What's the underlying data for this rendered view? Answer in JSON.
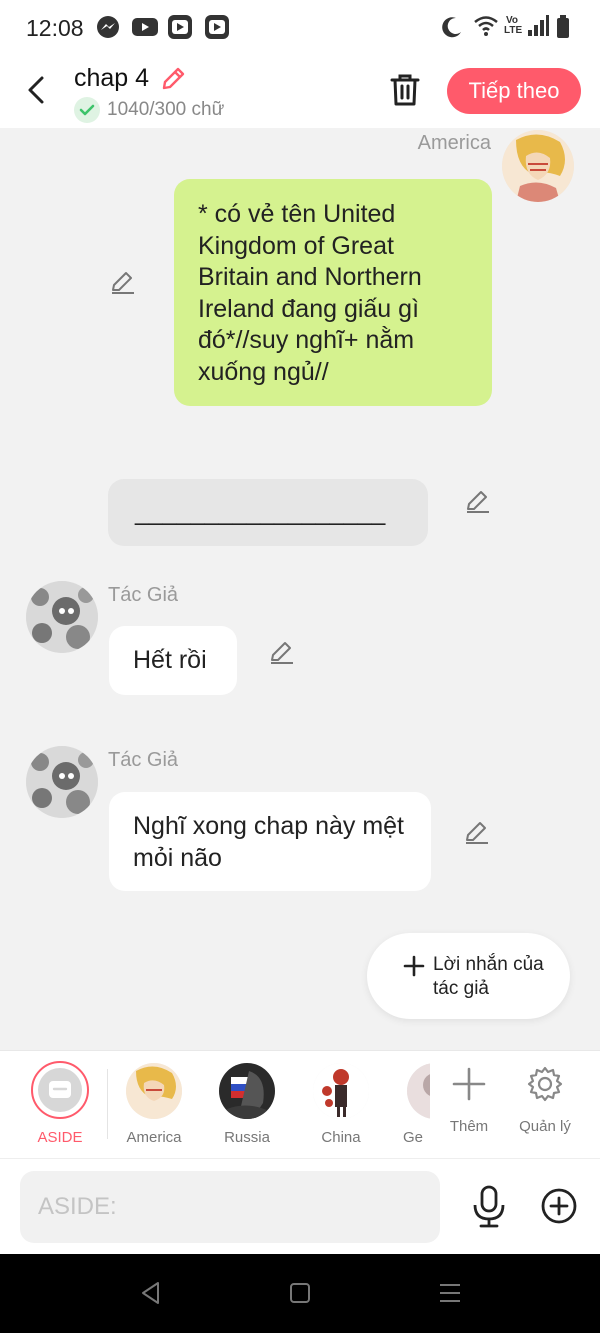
{
  "status_bar": {
    "time": "12:08",
    "icons_left": [
      "messenger-icon",
      "youtube-icon",
      "video-app-icon",
      "video-app-icon-2"
    ],
    "icons_right": [
      "do-not-disturb-moon-icon",
      "wifi-icon",
      "volte-icon",
      "signal-icon",
      "battery-icon"
    ],
    "volte_text": "Vo LTE"
  },
  "header": {
    "title": "chap 4",
    "word_count": "1040/300 chữ",
    "next_label": "Tiếp theo"
  },
  "chat": {
    "messages": [
      {
        "sender": "America",
        "side": "right",
        "text": "* có vẻ tên United Kingdom of Great Britain and Northern Ireland đang giấu gì đó*//suy nghĩ+ nằm xuống ngủ//"
      },
      {
        "sender": "",
        "side": "aside",
        "text": "__________________"
      },
      {
        "sender": "Tác Giả",
        "side": "left",
        "text": "Hết rồi"
      },
      {
        "sender": "Tác Giả",
        "side": "left",
        "text": "Nghĩ xong chap này mệt mỏi não"
      }
    ],
    "author_note_label": "Lời nhắn của tác giả"
  },
  "characters": {
    "aside_label": "ASIDE",
    "items": [
      {
        "label": "America"
      },
      {
        "label": "Russia"
      },
      {
        "label": "China"
      },
      {
        "label": "Ge"
      }
    ],
    "add_label": "Thêm",
    "manage_label": "Quản lý"
  },
  "input": {
    "placeholder": "ASIDE:"
  },
  "colors": {
    "accent": "#ff5a6b",
    "bubble_green": "#d5f28f",
    "bubble_white": "#ffffff",
    "background": "#f2f2f2"
  }
}
